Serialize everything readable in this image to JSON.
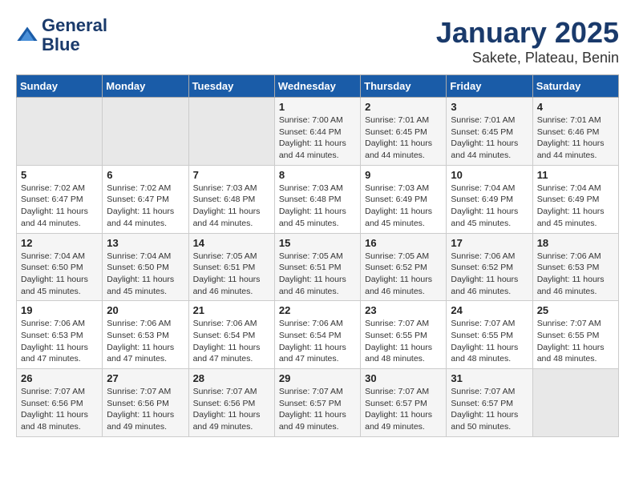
{
  "header": {
    "logo_line1": "General",
    "logo_line2": "Blue",
    "title": "January 2025",
    "subtitle": "Sakete, Plateau, Benin"
  },
  "weekdays": [
    "Sunday",
    "Monday",
    "Tuesday",
    "Wednesday",
    "Thursday",
    "Friday",
    "Saturday"
  ],
  "weeks": [
    [
      {
        "day": "",
        "info": ""
      },
      {
        "day": "",
        "info": ""
      },
      {
        "day": "",
        "info": ""
      },
      {
        "day": "1",
        "info": "Sunrise: 7:00 AM\nSunset: 6:44 PM\nDaylight: 11 hours and 44 minutes."
      },
      {
        "day": "2",
        "info": "Sunrise: 7:01 AM\nSunset: 6:45 PM\nDaylight: 11 hours and 44 minutes."
      },
      {
        "day": "3",
        "info": "Sunrise: 7:01 AM\nSunset: 6:45 PM\nDaylight: 11 hours and 44 minutes."
      },
      {
        "day": "4",
        "info": "Sunrise: 7:01 AM\nSunset: 6:46 PM\nDaylight: 11 hours and 44 minutes."
      }
    ],
    [
      {
        "day": "5",
        "info": "Sunrise: 7:02 AM\nSunset: 6:47 PM\nDaylight: 11 hours and 44 minutes."
      },
      {
        "day": "6",
        "info": "Sunrise: 7:02 AM\nSunset: 6:47 PM\nDaylight: 11 hours and 44 minutes."
      },
      {
        "day": "7",
        "info": "Sunrise: 7:03 AM\nSunset: 6:48 PM\nDaylight: 11 hours and 44 minutes."
      },
      {
        "day": "8",
        "info": "Sunrise: 7:03 AM\nSunset: 6:48 PM\nDaylight: 11 hours and 45 minutes."
      },
      {
        "day": "9",
        "info": "Sunrise: 7:03 AM\nSunset: 6:49 PM\nDaylight: 11 hours and 45 minutes."
      },
      {
        "day": "10",
        "info": "Sunrise: 7:04 AM\nSunset: 6:49 PM\nDaylight: 11 hours and 45 minutes."
      },
      {
        "day": "11",
        "info": "Sunrise: 7:04 AM\nSunset: 6:49 PM\nDaylight: 11 hours and 45 minutes."
      }
    ],
    [
      {
        "day": "12",
        "info": "Sunrise: 7:04 AM\nSunset: 6:50 PM\nDaylight: 11 hours and 45 minutes."
      },
      {
        "day": "13",
        "info": "Sunrise: 7:04 AM\nSunset: 6:50 PM\nDaylight: 11 hours and 45 minutes."
      },
      {
        "day": "14",
        "info": "Sunrise: 7:05 AM\nSunset: 6:51 PM\nDaylight: 11 hours and 46 minutes."
      },
      {
        "day": "15",
        "info": "Sunrise: 7:05 AM\nSunset: 6:51 PM\nDaylight: 11 hours and 46 minutes."
      },
      {
        "day": "16",
        "info": "Sunrise: 7:05 AM\nSunset: 6:52 PM\nDaylight: 11 hours and 46 minutes."
      },
      {
        "day": "17",
        "info": "Sunrise: 7:06 AM\nSunset: 6:52 PM\nDaylight: 11 hours and 46 minutes."
      },
      {
        "day": "18",
        "info": "Sunrise: 7:06 AM\nSunset: 6:53 PM\nDaylight: 11 hours and 46 minutes."
      }
    ],
    [
      {
        "day": "19",
        "info": "Sunrise: 7:06 AM\nSunset: 6:53 PM\nDaylight: 11 hours and 47 minutes."
      },
      {
        "day": "20",
        "info": "Sunrise: 7:06 AM\nSunset: 6:53 PM\nDaylight: 11 hours and 47 minutes."
      },
      {
        "day": "21",
        "info": "Sunrise: 7:06 AM\nSunset: 6:54 PM\nDaylight: 11 hours and 47 minutes."
      },
      {
        "day": "22",
        "info": "Sunrise: 7:06 AM\nSunset: 6:54 PM\nDaylight: 11 hours and 47 minutes."
      },
      {
        "day": "23",
        "info": "Sunrise: 7:07 AM\nSunset: 6:55 PM\nDaylight: 11 hours and 48 minutes."
      },
      {
        "day": "24",
        "info": "Sunrise: 7:07 AM\nSunset: 6:55 PM\nDaylight: 11 hours and 48 minutes."
      },
      {
        "day": "25",
        "info": "Sunrise: 7:07 AM\nSunset: 6:55 PM\nDaylight: 11 hours and 48 minutes."
      }
    ],
    [
      {
        "day": "26",
        "info": "Sunrise: 7:07 AM\nSunset: 6:56 PM\nDaylight: 11 hours and 48 minutes."
      },
      {
        "day": "27",
        "info": "Sunrise: 7:07 AM\nSunset: 6:56 PM\nDaylight: 11 hours and 49 minutes."
      },
      {
        "day": "28",
        "info": "Sunrise: 7:07 AM\nSunset: 6:56 PM\nDaylight: 11 hours and 49 minutes."
      },
      {
        "day": "29",
        "info": "Sunrise: 7:07 AM\nSunset: 6:57 PM\nDaylight: 11 hours and 49 minutes."
      },
      {
        "day": "30",
        "info": "Sunrise: 7:07 AM\nSunset: 6:57 PM\nDaylight: 11 hours and 49 minutes."
      },
      {
        "day": "31",
        "info": "Sunrise: 7:07 AM\nSunset: 6:57 PM\nDaylight: 11 hours and 50 minutes."
      },
      {
        "day": "",
        "info": ""
      }
    ]
  ]
}
